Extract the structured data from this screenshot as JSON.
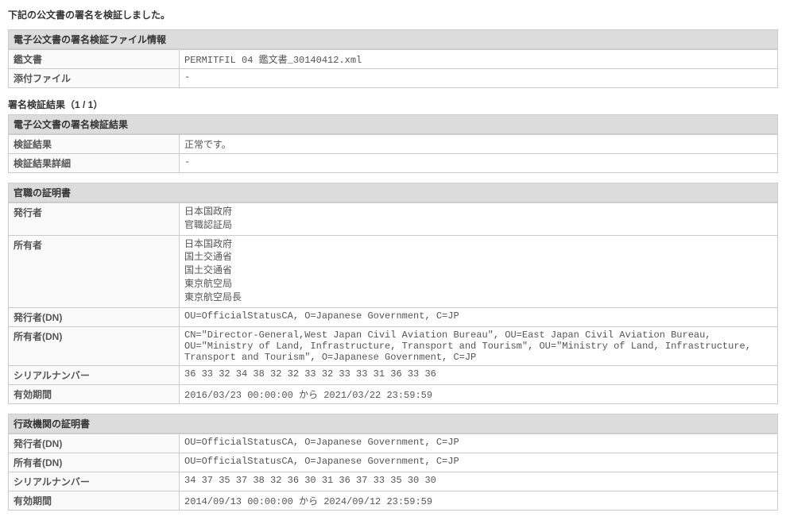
{
  "intro": "下記の公文書の署名を検証しました。",
  "file_info": {
    "header": "電子公文書の署名検証ファイル情報",
    "rows": {
      "kanbunsho_label": "鑑文書",
      "kanbunsho_value": "PERMITFIL 04 鑑文書_30140412.xml",
      "attachment_label": "添付ファイル",
      "attachment_value": "-"
    }
  },
  "verify_result_title": "署名検証結果（1 / 1）",
  "verify_result": {
    "header": "電子公文書の署名検証結果",
    "rows": {
      "result_label": "検証結果",
      "result_value": "正常です。",
      "detail_label": "検証結果詳細",
      "detail_value": "-"
    }
  },
  "official_cert": {
    "header": "官職の証明書",
    "rows": {
      "issuer_label": "発行者",
      "issuer_line1": "日本国政府",
      "issuer_line2": "官職認証局",
      "owner_label": "所有者",
      "owner_line1": "日本国政府",
      "owner_line2": "国土交通省",
      "owner_line3": "国土交通省",
      "owner_line4": "東京航空局",
      "owner_line5": "東京航空局長",
      "issuer_dn_label": "発行者(DN)",
      "issuer_dn_value": "OU=OfficialStatusCA, O=Japanese Government, C=JP",
      "owner_dn_label": "所有者(DN)",
      "owner_dn_value": "CN=\"Director-General,West Japan Civil Aviation Bureau\", OU=East Japan Civil Aviation Bureau, OU=\"Ministry of Land, Infrastructure, Transport and Tourism\", OU=\"Ministry of Land, Infrastructure, Transport and Tourism\", O=Japanese Government, C=JP",
      "serial_label": "シリアルナンバー",
      "serial_value": "36 33 32 34 38 32 32 33 32 33 33 31 36 33 36",
      "validity_label": "有効期間",
      "validity_value": "2016/03/23 00:00:00 から 2021/03/22 23:59:59"
    }
  },
  "agency_cert": {
    "header": "行政機関の証明書",
    "rows": {
      "issuer_dn_label": "発行者(DN)",
      "issuer_dn_value": "OU=OfficialStatusCA, O=Japanese Government, C=JP",
      "owner_dn_label": "所有者(DN)",
      "owner_dn_value": "OU=OfficialStatusCA, O=Japanese Government, C=JP",
      "serial_label": "シリアルナンバー",
      "serial_value": "34 37 35 37 38 32 36 30 31 36 37 33 35 30 30",
      "validity_label": "有効期間",
      "validity_value": "2014/09/13 00:00:00 から 2024/09/12 23:59:59"
    }
  }
}
